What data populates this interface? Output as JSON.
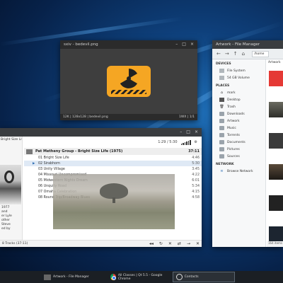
{
  "viewer": {
    "title": "sxiv - bedevil.png",
    "status_left": "12K | 128x128 | bedevil.png",
    "status_right": "1WX | 1/1"
  },
  "file_manager": {
    "title": "Artwork - File Manager",
    "path": "/home",
    "devices_heading": "DEVICES",
    "devices": [
      "File System",
      "54 GB Volume"
    ],
    "places_heading": "PLACES",
    "places": [
      "mark",
      "Desktop",
      "Trash",
      "Downloads",
      "Artwork",
      "Music",
      "Torrents",
      "Documents",
      "Pictures",
      "Sources"
    ],
    "network_heading": "NETWORK",
    "network": [
      "Browse Network"
    ],
    "content_label": "Artwork",
    "status": "164 items"
  },
  "player": {
    "side_heading": "Bright Size Life (1975)",
    "side_text": [
      "1977",
      "and",
      "er Lyle",
      "other",
      "Steve",
      "ed by"
    ],
    "position": "1:29 / 5:30",
    "album": {
      "title": "Pat Metheny Group - Bright Size Life (1975)",
      "duration": "37:11"
    },
    "tracks": [
      {
        "name": "01 Bright Size Life",
        "length": "4:46"
      },
      {
        "name": "02 Sirabhorn",
        "length": "5:30"
      },
      {
        "name": "03 Unity Village",
        "length": "3:45"
      },
      {
        "name": "04 Missouri Uncompromised",
        "length": "4:22"
      },
      {
        "name": "05 Midwestern Nights Dream",
        "length": "6:01"
      },
      {
        "name": "06 Unquity Road",
        "length": "5:34"
      },
      {
        "name": "07 Omaha Celebration",
        "length": "4:15"
      },
      {
        "name": "08 Round Trip/Broadway Blues",
        "length": "4:58"
      }
    ],
    "active_track": 1,
    "footer": "8 Tracks (37:11)",
    "controls": [
      "◂◂",
      "↻",
      "✕",
      "⇄",
      "→",
      "✕"
    ]
  },
  "taskbar": {
    "items": [
      "Artwork - File Manager",
      "All Classes | Qt 5.5 - Google Chrome",
      "Contacts"
    ]
  },
  "colors": {
    "accent_orange": "#f5a623",
    "selection": "#dfe9f5"
  }
}
